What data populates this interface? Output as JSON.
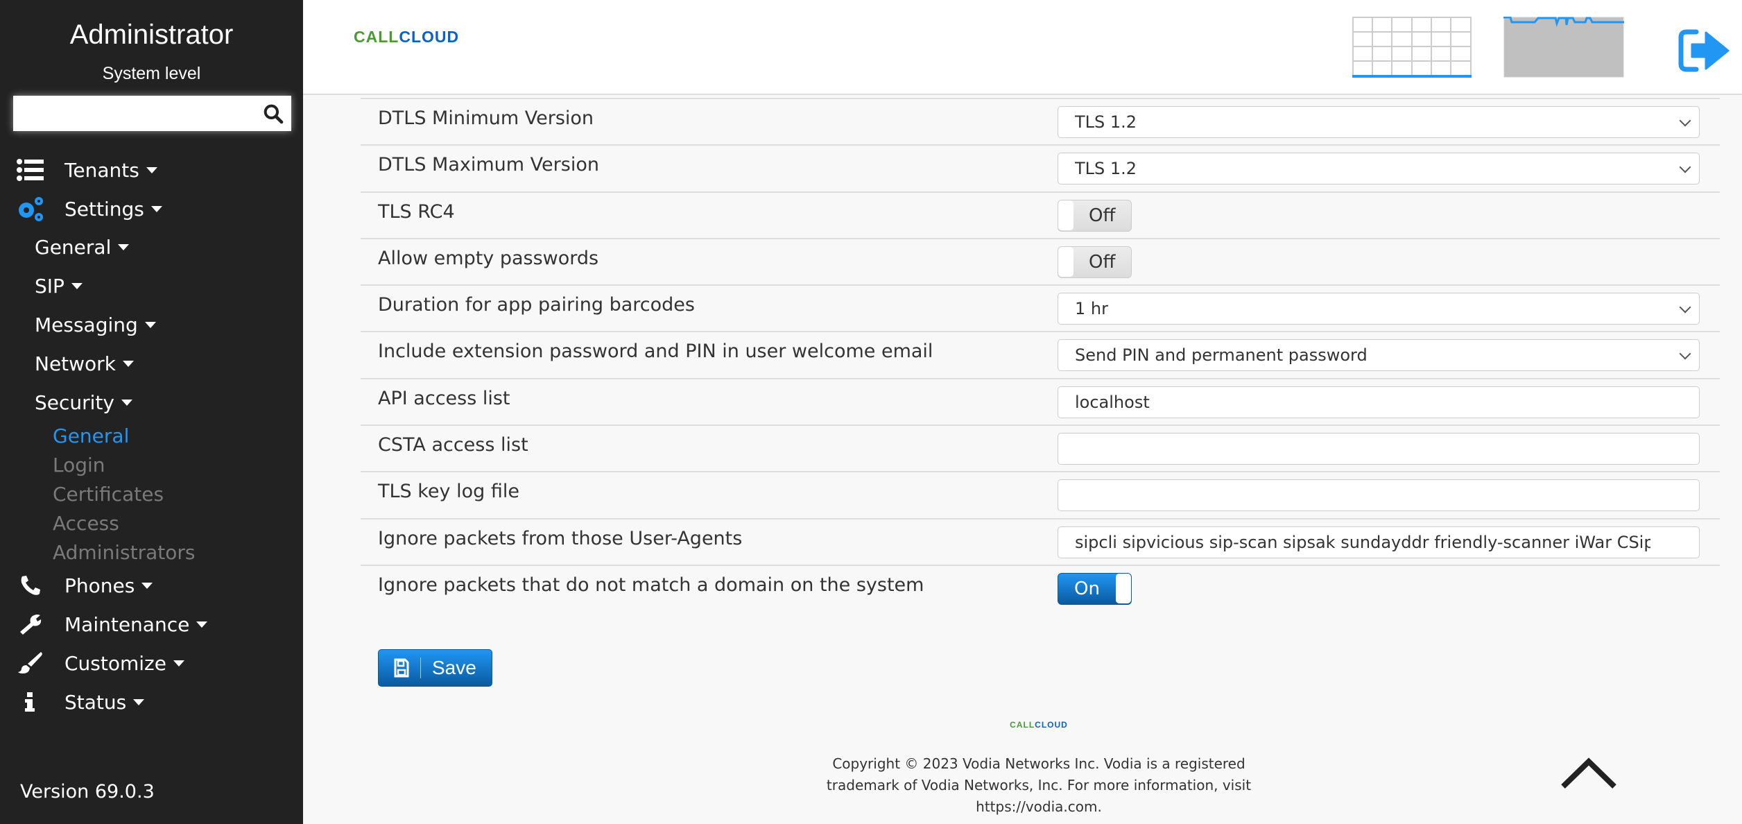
{
  "sidebar": {
    "title": "Administrator",
    "subtitle": "System level",
    "search_placeholder": "",
    "items": [
      {
        "label": "Tenants",
        "icon": "list-icon"
      },
      {
        "label": "Settings",
        "icon": "gears-icon"
      },
      {
        "label": "Phones",
        "icon": "phone-icon"
      },
      {
        "label": "Maintenance",
        "icon": "wrench-icon"
      },
      {
        "label": "Customize",
        "icon": "brush-icon"
      },
      {
        "label": "Status",
        "icon": "info-icon"
      }
    ],
    "settings_sub": [
      "General",
      "SIP",
      "Messaging",
      "Network",
      "Security"
    ],
    "security_sub": [
      "General",
      "Login",
      "Certificates",
      "Access",
      "Administrators"
    ],
    "active_sub": "General",
    "version": "Version 69.0.3"
  },
  "header": {
    "logo_a": "CALL",
    "logo_b": "CLOUD",
    "icons": [
      "calendar-grid-icon",
      "usage-graph-icon",
      "logout-icon"
    ]
  },
  "form": {
    "rows": [
      {
        "label": "DTLS Minimum Version",
        "type": "select",
        "value": "TLS 1.2"
      },
      {
        "label": "DTLS Maximum Version",
        "type": "select",
        "value": "TLS 1.2"
      },
      {
        "label": "TLS RC4",
        "type": "toggle",
        "value": "Off"
      },
      {
        "label": "Allow empty passwords",
        "type": "toggle",
        "value": "Off"
      },
      {
        "label": "Duration for app pairing barcodes",
        "type": "select",
        "value": "1 hr"
      },
      {
        "label": "Include extension password and PIN in user welcome email",
        "type": "select",
        "value": "Send PIN and permanent password"
      },
      {
        "label": "API access list",
        "type": "input",
        "value": "localhost"
      },
      {
        "label": "CSTA access list",
        "type": "input",
        "value": ""
      },
      {
        "label": "TLS key log file",
        "type": "input",
        "value": ""
      },
      {
        "label": "Ignore packets from those User-Agents",
        "type": "input",
        "value": "sipcli sipvicious sip-scan sipsak sundayddr friendly-scanner iWar CSip"
      },
      {
        "label": "Ignore packets that do not match a domain on the system",
        "type": "toggle",
        "value": "On"
      }
    ],
    "save_label": "Save"
  },
  "footer": {
    "lines": [
      "Copyright © 2023 Vodia Networks Inc. Vodia is a registered",
      "trademark of Vodia Networks, Inc. For more information, visit",
      "https://vodia.com."
    ]
  },
  "colors": {
    "accent": "#2196f3",
    "sidebar_bg": "#222222",
    "logo_green": "#4a9a35",
    "logo_blue": "#0a63c4"
  }
}
